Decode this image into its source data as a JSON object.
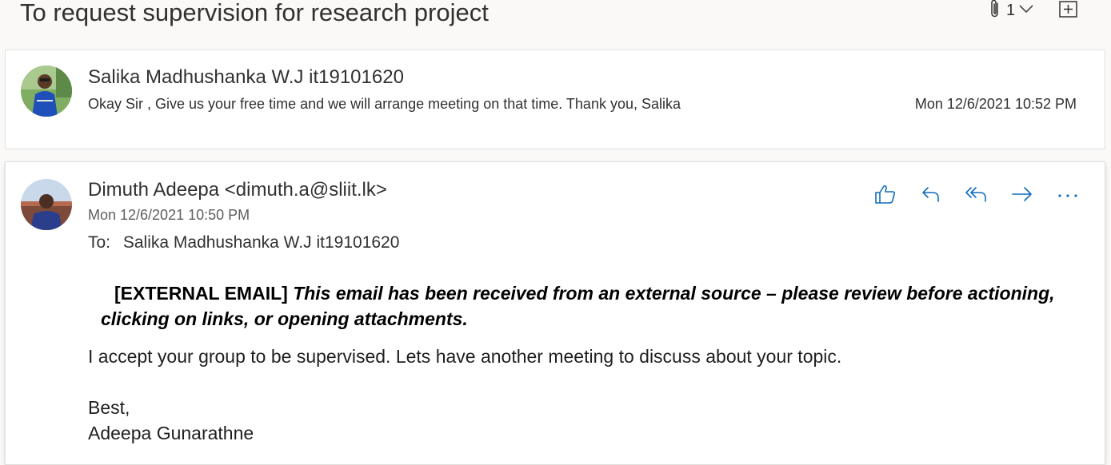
{
  "subject": "To request supervision for research project",
  "attachment_count": "1",
  "messages": [
    {
      "sender": "Salika Madhushanka W.J it19101620",
      "preview": "Okay Sir , Give us your free time and we will arrange meeting on that time. Thank you, Salika",
      "date": "Mon 12/6/2021 10:52 PM"
    },
    {
      "sender": "Dimuth Adeepa <dimuth.a@sliit.lk>",
      "date": "Mon 12/6/2021 10:50 PM",
      "to_label": "To:",
      "to": "Salika Madhushanka W.J it19101620",
      "warning_tag": "[EXTERNAL EMAIL]",
      "warning_text": "This email has been received from an external source – please review before actioning, clicking on links, or opening attachments.",
      "body": "I accept your group to be supervised. Lets have another meeting to discuss about your topic.",
      "signoff": "Best,",
      "signature": "Adeepa Gunarathne"
    }
  ],
  "icons": {
    "attachment": "paperclip-icon",
    "dropdown": "chevron-down-icon",
    "expand": "expand-all-icon",
    "like": "thumbs-up-icon",
    "reply": "reply-icon",
    "reply_all": "reply-all-icon",
    "forward": "forward-icon",
    "more": "more-icon"
  },
  "colors": {
    "accent": "#0f6cbd",
    "background": "#faf9f8",
    "card": "#ffffff"
  }
}
